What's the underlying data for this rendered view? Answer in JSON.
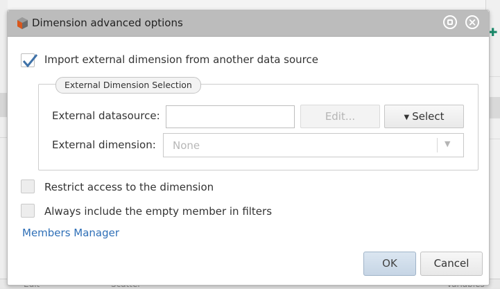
{
  "background": {
    "bottom_fragments": [
      "Edit",
      "Scatter",
      "• Variables"
    ]
  },
  "dialog": {
    "title": "Dimension advanced options",
    "logo_icon": "app-cube-logo-icon",
    "options": {
      "import_external": {
        "label": "Import external dimension from another data source",
        "checked": true
      },
      "restrict_access": {
        "label": "Restrict access to the dimension",
        "checked": false
      },
      "include_empty": {
        "label": "Always include the empty member in filters",
        "checked": false
      }
    },
    "external_selection": {
      "legend": "External Dimension Selection",
      "datasource_label": "External datasource:",
      "datasource_value": "",
      "edit_button": "Edit...",
      "select_button": "Select",
      "dimension_label": "External dimension:",
      "dimension_value": "None"
    },
    "members_manager_link": "Members Manager",
    "ok_button": "OK",
    "cancel_button": "Cancel"
  },
  "colors": {
    "titlebar": "#bcbcbc",
    "link": "#2e6fb7",
    "check": "#3f72a8"
  }
}
